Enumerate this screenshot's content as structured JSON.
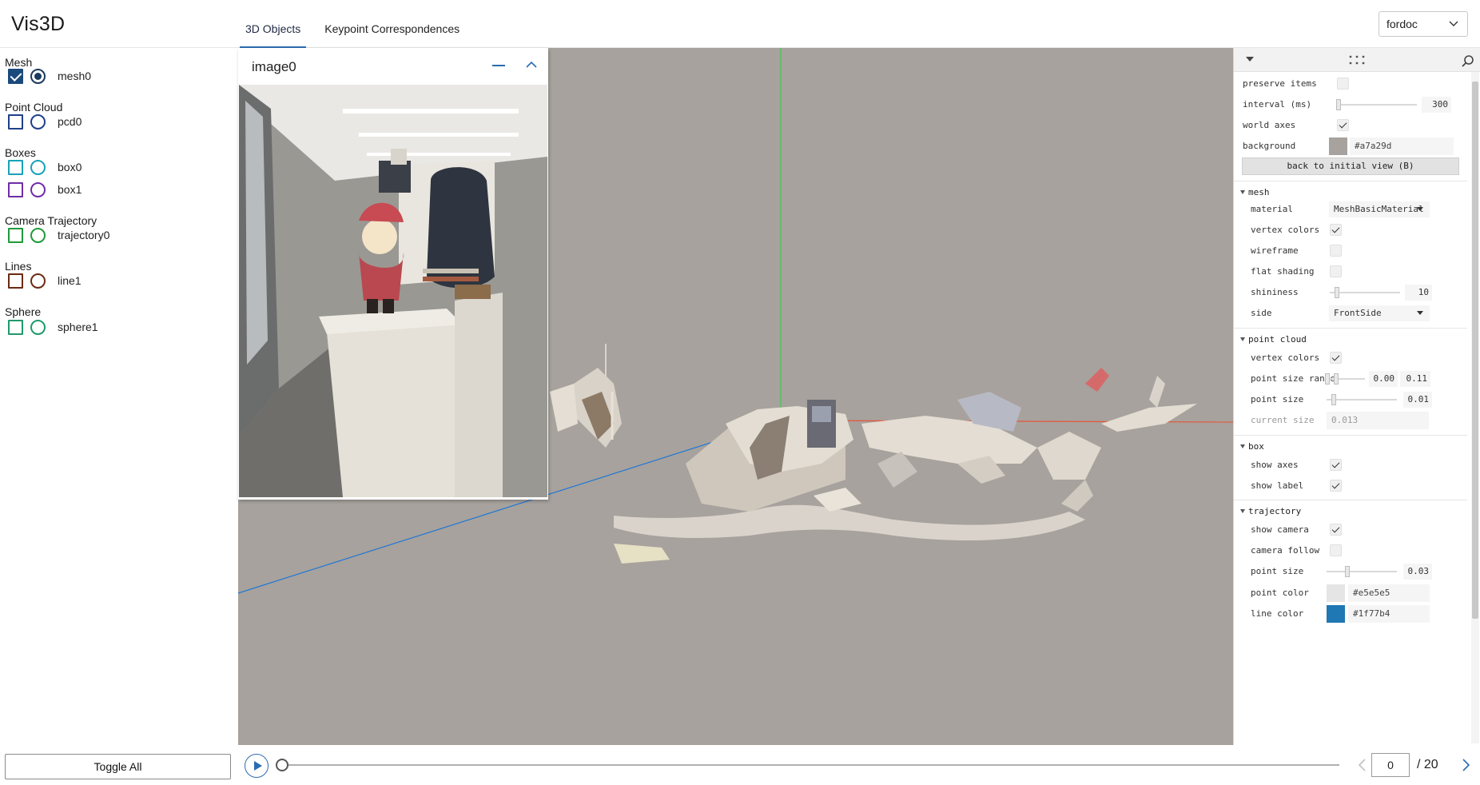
{
  "app": {
    "title": "Vis3D"
  },
  "header": {
    "tabs": [
      {
        "label": "3D Objects",
        "active": true
      },
      {
        "label": "Keypoint Correspondences",
        "active": false
      }
    ],
    "user_select": "fordoc"
  },
  "sidebar": {
    "groups": [
      {
        "title": "Mesh",
        "items": [
          {
            "label": "mesh0",
            "color": "#1a4a7c",
            "checked": true,
            "selected": true
          }
        ]
      },
      {
        "title": "Point Cloud",
        "items": [
          {
            "label": "pcd0",
            "color": "#1f3f8a",
            "checked": false,
            "selected": false
          }
        ]
      },
      {
        "title": "Boxes",
        "items": [
          {
            "label": "box0",
            "color": "#17a2b8",
            "checked": false,
            "selected": false
          },
          {
            "label": "box1",
            "color": "#6f2da8",
            "checked": false,
            "selected": false
          }
        ]
      },
      {
        "title": "Camera Trajectory",
        "items": [
          {
            "label": "trajectory0",
            "color": "#1f9a3a",
            "checked": false,
            "selected": false
          }
        ]
      },
      {
        "title": "Lines",
        "items": [
          {
            "label": "line1",
            "color": "#6b2a12",
            "checked": false,
            "selected": false
          }
        ]
      },
      {
        "title": "Sphere",
        "items": [
          {
            "label": "sphere1",
            "color": "#1f9a6a",
            "checked": false,
            "selected": false
          }
        ]
      }
    ],
    "toggle_all": "Toggle All"
  },
  "image_panel": {
    "title": "image0"
  },
  "gui": {
    "general": {
      "preserve_items": {
        "label": "preserve items",
        "checked": false
      },
      "interval": {
        "label": "interval (ms)",
        "value": "300",
        "fraction": 0.02
      },
      "world_axes": {
        "label": "world axes",
        "checked": true
      },
      "background": {
        "label": "background",
        "value": "#a7a29d",
        "color": "#a7a29d"
      },
      "back_button": "back to initial view (B)"
    },
    "mesh": {
      "title": "mesh",
      "material": {
        "label": "material",
        "value": "MeshBasicMaterial"
      },
      "vertex_colors": {
        "label": "vertex colors",
        "checked": true
      },
      "wireframe": {
        "label": "wireframe",
        "checked": false
      },
      "flat_shading": {
        "label": "flat shading",
        "checked": false
      },
      "shininess": {
        "label": "shininess",
        "value": "10",
        "fraction": 0.1
      },
      "side": {
        "label": "side",
        "value": "FrontSide"
      }
    },
    "point_cloud": {
      "title": "point cloud",
      "vertex_colors": {
        "label": "vertex colors",
        "checked": true
      },
      "point_size_range": {
        "label": "point size range",
        "min": "0.00",
        "max": "0.11"
      },
      "point_size": {
        "label": "point size",
        "value": "0.01",
        "fraction": 0.1
      },
      "current_size": {
        "label": "current size",
        "value": "0.013"
      }
    },
    "box": {
      "title": "box",
      "show_axes": {
        "label": "show axes",
        "checked": true
      },
      "show_label": {
        "label": "show label",
        "checked": true
      }
    },
    "trajectory": {
      "title": "trajectory",
      "show_camera": {
        "label": "show camera",
        "checked": true
      },
      "camera_follow": {
        "label": "camera follow",
        "checked": false
      },
      "point_size": {
        "label": "point size",
        "value": "0.03",
        "fraction": 0.3
      },
      "point_color": {
        "label": "point color",
        "value": "#e5e5e5",
        "color": "#e5e5e5"
      },
      "line_color": {
        "label": "line color",
        "value": "#1f77b4",
        "color": "#1f77b4"
      }
    }
  },
  "timeline": {
    "frame": "0",
    "total": "/ 20",
    "fraction": 0.0
  },
  "colors": {
    "accent": "#2b6cb0",
    "viewport_bg": "#a7a29d",
    "axis_x": "#e8553a",
    "axis_y": "#43c653",
    "axis_z": "#1f77d4"
  }
}
